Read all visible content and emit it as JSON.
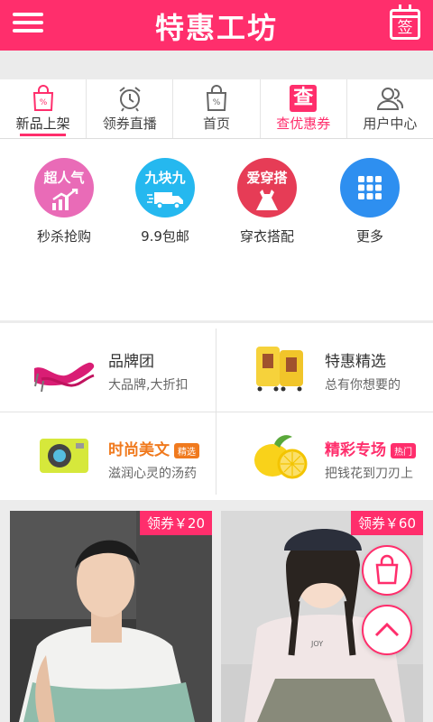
{
  "header": {
    "title": "特惠工坊",
    "sign_label": "签",
    "menu_icon": "hamburger-icon",
    "brand_color": "#ff2e6c"
  },
  "tabs": [
    {
      "label": "新品上架",
      "icon": "shopping-bag-percent-icon",
      "active": true
    },
    {
      "label": "领券直播",
      "icon": "alarm-clock-icon"
    },
    {
      "label": "首页",
      "icon": "bag-percent-icon"
    },
    {
      "label": "查优惠券",
      "icon": "search-coupon-icon",
      "icon_text": "查",
      "highlight": true
    },
    {
      "label": "用户中心",
      "icon": "users-icon"
    }
  ],
  "categories": [
    {
      "label": "秒杀抢购",
      "badge_text": "超人气",
      "icon": "trending-up-chart-icon",
      "color": "#e96bb7"
    },
    {
      "label": "9.9包邮",
      "badge_text": "九块九",
      "icon": "delivery-truck-icon",
      "color": "#25b8ef"
    },
    {
      "label": "穿衣搭配",
      "badge_text": "爱穿搭",
      "icon": "dress-icon",
      "color": "#e63c56"
    },
    {
      "label": "更多",
      "icon": "grid-icon",
      "color": "#2e8ff0"
    }
  ],
  "promos": [
    {
      "title": "品牌团",
      "subtitle": "大品牌,大折扣",
      "icon": "high-heel-shoe-icon"
    },
    {
      "title": "特惠精选",
      "subtitle": "总有你想要的",
      "icon": "suitcase-icon"
    },
    {
      "title": "时尚美文",
      "badge": "精选",
      "subtitle": "滋润心灵的汤药",
      "icon": "action-camera-icon",
      "accent": "#f07a1e"
    },
    {
      "title": "精彩专场",
      "badge": "热门",
      "subtitle": "把钱花到刀刃上",
      "icon": "lemon-icon",
      "accent": "#ff2e6c"
    }
  ],
  "products": [
    {
      "coupon": "领券￥20",
      "image": "man-in-tshirt-photo"
    },
    {
      "coupon": "领券￥60",
      "image": "girl-in-sweater-photo"
    }
  ],
  "floating": {
    "cart_icon": "shopping-bag-icon",
    "top_icon": "chevron-up-icon"
  }
}
